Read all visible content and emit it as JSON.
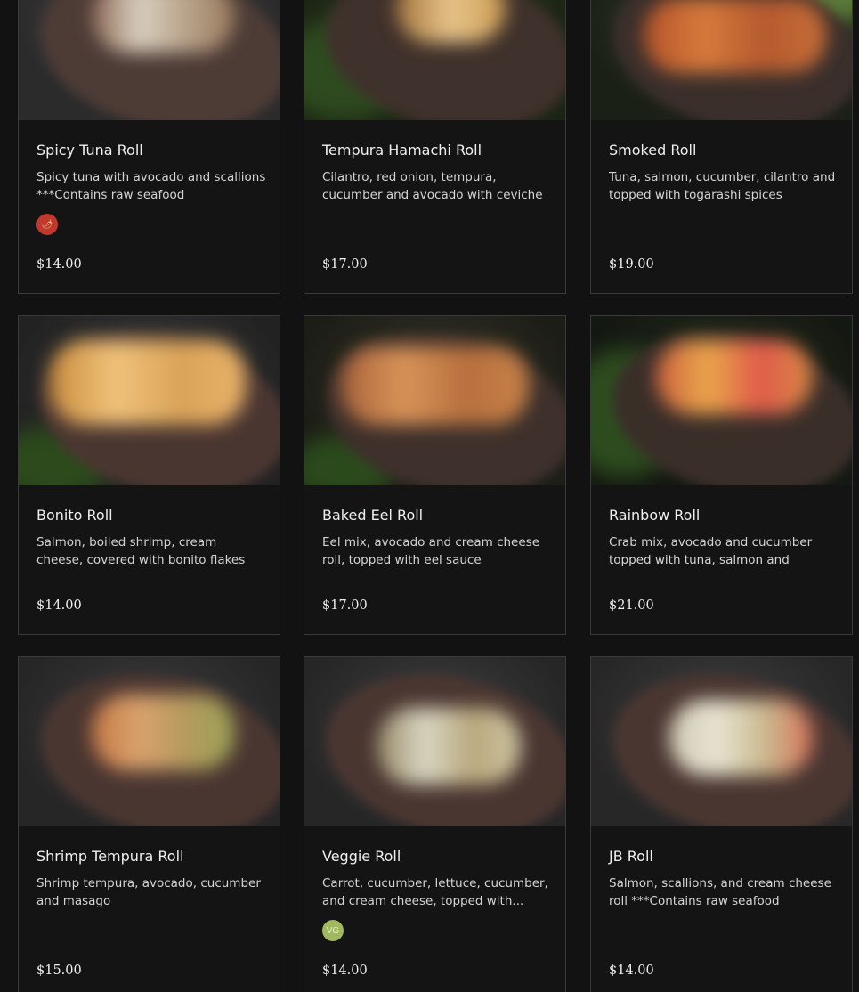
{
  "menu": {
    "items": [
      {
        "name": "Spicy Tuna Roll",
        "description": "Spicy tuna with avocado and scallions ***Contains raw seafood",
        "price": "$14.00",
        "badge": "spicy-icon"
      },
      {
        "name": "Tempura Hamachi Roll",
        "description": "Cilantro, red onion, tempura, cucumber and avocado with ceviche base...",
        "price": "$17.00"
      },
      {
        "name": "Smoked Roll",
        "description": "Tuna, salmon, cucumber, cilantro and topped with togarashi spices",
        "price": "$19.00"
      },
      {
        "name": "Bonito Roll",
        "description": "Salmon, boiled shrimp, cream cheese, covered with bonito flakes ***Contain...",
        "price": "$14.00"
      },
      {
        "name": "Baked Eel Roll",
        "description": "Eel mix, avocado and cream cheese roll, topped with eel sauce",
        "price": "$17.00"
      },
      {
        "name": "Rainbow Roll",
        "description": "Crab mix, avocado and cucumber topped with tuna, salmon and avoca...",
        "price": "$21.00"
      },
      {
        "name": "Shrimp Tempura Roll",
        "description": "Shrimp tempura, avocado, cucumber and masago",
        "price": "$15.00"
      },
      {
        "name": "Veggie Roll",
        "description": "Carrot, cucumber, lettuce, cucumber, and cream cheese, topped with...",
        "price": "$14.00",
        "badge": "vegetarian-icon",
        "badge_label": "VG"
      },
      {
        "name": "JB Roll",
        "description": "Salmon, scallions, and cream cheese roll ***Contains raw seafood",
        "price": "$14.00"
      }
    ]
  },
  "icons": {
    "spicy": "chili-pepper-icon",
    "spicy_glyph": "🌶",
    "vegetarian_label": "VG"
  }
}
